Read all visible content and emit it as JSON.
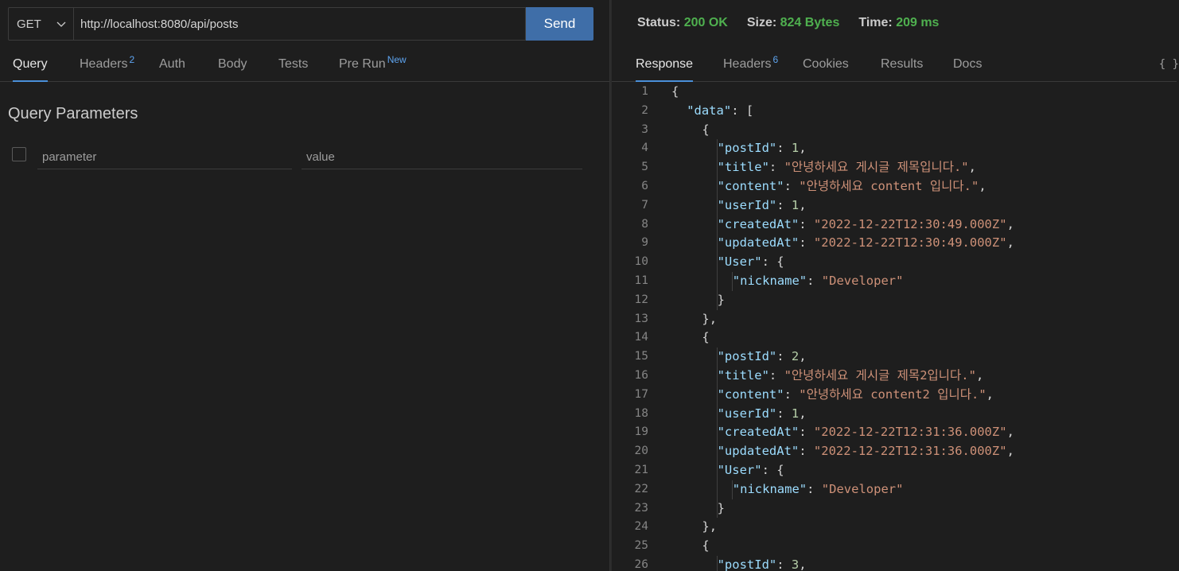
{
  "request": {
    "method": "GET",
    "url": "http://localhost:8080/api/posts",
    "send_label": "Send"
  },
  "request_tabs": [
    {
      "label": "Query",
      "badge": "",
      "active": true
    },
    {
      "label": "Headers",
      "badge": "2",
      "active": false
    },
    {
      "label": "Auth",
      "badge": "",
      "active": false
    },
    {
      "label": "Body",
      "badge": "",
      "active": false
    },
    {
      "label": "Tests",
      "badge": "",
      "active": false
    },
    {
      "label": "Pre Run",
      "badge": "New",
      "active": false
    }
  ],
  "query": {
    "title": "Query Parameters",
    "param_placeholder": "parameter",
    "value_placeholder": "value"
  },
  "status": {
    "status_label": "Status:",
    "status_value": "200 OK",
    "size_label": "Size:",
    "size_value": "824 Bytes",
    "time_label": "Time:",
    "time_value": "209 ms"
  },
  "response_tabs": [
    {
      "label": "Response",
      "badge": "",
      "active": true
    },
    {
      "label": "Headers",
      "badge": "6",
      "active": false
    },
    {
      "label": "Cookies",
      "badge": "",
      "active": false
    },
    {
      "label": "Results",
      "badge": "",
      "active": false
    },
    {
      "label": "Docs",
      "badge": "",
      "active": false
    }
  ],
  "braces_label": "{ }",
  "colors": {
    "accent": "#4a8fd9",
    "send": "#3f6ea8",
    "status_ok": "#4fb04f",
    "json_key": "#9cdcfe",
    "json_string": "#ce9178",
    "json_number": "#b5cea8"
  },
  "response_lines": [
    {
      "n": "1",
      "indent": 0,
      "tokens": [
        [
          "p",
          "{"
        ]
      ]
    },
    {
      "n": "2",
      "indent": 1,
      "tokens": [
        [
          "k",
          "\"data\""
        ],
        [
          "p",
          ": ["
        ]
      ]
    },
    {
      "n": "3",
      "indent": 2,
      "tokens": [
        [
          "p",
          "{"
        ]
      ]
    },
    {
      "n": "4",
      "indent": 3,
      "tokens": [
        [
          "k",
          "\"postId\""
        ],
        [
          "p",
          ": "
        ],
        [
          "n",
          "1"
        ],
        [
          "p",
          ","
        ]
      ]
    },
    {
      "n": "5",
      "indent": 3,
      "tokens": [
        [
          "k",
          "\"title\""
        ],
        [
          "p",
          ": "
        ],
        [
          "s",
          "\"안녕하세요 게시글 제목입니다.\""
        ],
        [
          "p",
          ","
        ]
      ]
    },
    {
      "n": "6",
      "indent": 3,
      "tokens": [
        [
          "k",
          "\"content\""
        ],
        [
          "p",
          ": "
        ],
        [
          "s",
          "\"안녕하세요 content 입니다.\""
        ],
        [
          "p",
          ","
        ]
      ]
    },
    {
      "n": "7",
      "indent": 3,
      "tokens": [
        [
          "k",
          "\"userId\""
        ],
        [
          "p",
          ": "
        ],
        [
          "n",
          "1"
        ],
        [
          "p",
          ","
        ]
      ]
    },
    {
      "n": "8",
      "indent": 3,
      "tokens": [
        [
          "k",
          "\"createdAt\""
        ],
        [
          "p",
          ": "
        ],
        [
          "s",
          "\"2022-12-22T12:30:49.000Z\""
        ],
        [
          "p",
          ","
        ]
      ]
    },
    {
      "n": "9",
      "indent": 3,
      "tokens": [
        [
          "k",
          "\"updatedAt\""
        ],
        [
          "p",
          ": "
        ],
        [
          "s",
          "\"2022-12-22T12:30:49.000Z\""
        ],
        [
          "p",
          ","
        ]
      ]
    },
    {
      "n": "10",
      "indent": 3,
      "tokens": [
        [
          "k",
          "\"User\""
        ],
        [
          "p",
          ": {"
        ]
      ]
    },
    {
      "n": "11",
      "indent": 4,
      "tokens": [
        [
          "k",
          "\"nickname\""
        ],
        [
          "p",
          ": "
        ],
        [
          "s",
          "\"Developer\""
        ]
      ]
    },
    {
      "n": "12",
      "indent": 3,
      "tokens": [
        [
          "p",
          "}"
        ]
      ]
    },
    {
      "n": "13",
      "indent": 2,
      "tokens": [
        [
          "p",
          "},"
        ]
      ]
    },
    {
      "n": "14",
      "indent": 2,
      "tokens": [
        [
          "p",
          "{"
        ]
      ]
    },
    {
      "n": "15",
      "indent": 3,
      "tokens": [
        [
          "k",
          "\"postId\""
        ],
        [
          "p",
          ": "
        ],
        [
          "n",
          "2"
        ],
        [
          "p",
          ","
        ]
      ]
    },
    {
      "n": "16",
      "indent": 3,
      "tokens": [
        [
          "k",
          "\"title\""
        ],
        [
          "p",
          ": "
        ],
        [
          "s",
          "\"안녕하세요 게시글 제목2입니다.\""
        ],
        [
          "p",
          ","
        ]
      ]
    },
    {
      "n": "17",
      "indent": 3,
      "tokens": [
        [
          "k",
          "\"content\""
        ],
        [
          "p",
          ": "
        ],
        [
          "s",
          "\"안녕하세요 content2 입니다.\""
        ],
        [
          "p",
          ","
        ]
      ]
    },
    {
      "n": "18",
      "indent": 3,
      "tokens": [
        [
          "k",
          "\"userId\""
        ],
        [
          "p",
          ": "
        ],
        [
          "n",
          "1"
        ],
        [
          "p",
          ","
        ]
      ]
    },
    {
      "n": "19",
      "indent": 3,
      "tokens": [
        [
          "k",
          "\"createdAt\""
        ],
        [
          "p",
          ": "
        ],
        [
          "s",
          "\"2022-12-22T12:31:36.000Z\""
        ],
        [
          "p",
          ","
        ]
      ]
    },
    {
      "n": "20",
      "indent": 3,
      "tokens": [
        [
          "k",
          "\"updatedAt\""
        ],
        [
          "p",
          ": "
        ],
        [
          "s",
          "\"2022-12-22T12:31:36.000Z\""
        ],
        [
          "p",
          ","
        ]
      ]
    },
    {
      "n": "21",
      "indent": 3,
      "tokens": [
        [
          "k",
          "\"User\""
        ],
        [
          "p",
          ": {"
        ]
      ]
    },
    {
      "n": "22",
      "indent": 4,
      "tokens": [
        [
          "k",
          "\"nickname\""
        ],
        [
          "p",
          ": "
        ],
        [
          "s",
          "\"Developer\""
        ]
      ]
    },
    {
      "n": "23",
      "indent": 3,
      "tokens": [
        [
          "p",
          "}"
        ]
      ]
    },
    {
      "n": "24",
      "indent": 2,
      "tokens": [
        [
          "p",
          "},"
        ]
      ]
    },
    {
      "n": "25",
      "indent": 2,
      "tokens": [
        [
          "p",
          "{"
        ]
      ]
    },
    {
      "n": "26",
      "indent": 3,
      "tokens": [
        [
          "k",
          "\"postId\""
        ],
        [
          "p",
          ": "
        ],
        [
          "n",
          "3"
        ],
        [
          "p",
          ","
        ]
      ]
    }
  ]
}
